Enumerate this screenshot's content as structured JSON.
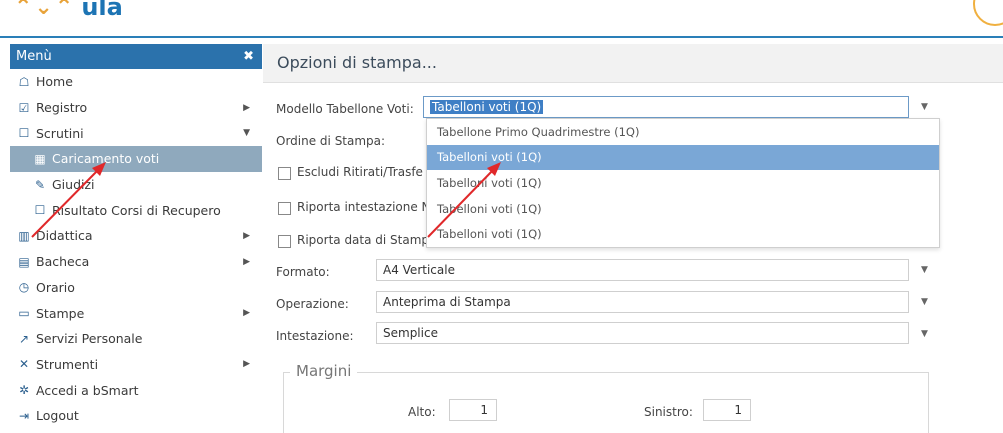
{
  "sidebar": {
    "title": "Menù",
    "close": "✖",
    "items": [
      {
        "label": "Home",
        "icon": "☖"
      },
      {
        "label": "Registro",
        "icon": "☑"
      },
      {
        "label": "Scrutini",
        "icon": "☐"
      },
      {
        "label": "Caricamento voti",
        "icon": "▦"
      },
      {
        "label": "Giudizi",
        "icon": "✎"
      },
      {
        "label": "Risultato Corsi di Recupero",
        "icon": "☐"
      },
      {
        "label": "Didattica",
        "icon": "▥"
      },
      {
        "label": "Bacheca",
        "icon": "▤"
      },
      {
        "label": "Orario",
        "icon": "◷"
      },
      {
        "label": "Stampe",
        "icon": "▭"
      },
      {
        "label": "Servizi Personale",
        "icon": "↗"
      },
      {
        "label": "Strumenti",
        "icon": "✕"
      },
      {
        "label": "Accedi a bSmart",
        "icon": "✲"
      },
      {
        "label": "Logout",
        "icon": "⇥"
      }
    ]
  },
  "main": {
    "title": "Opzioni di stampa...",
    "modello_label": "Modello Tabellone Voti:",
    "modello_value": "Tabelloni voti (1Q)",
    "ordine_label": "Ordine di Stampa:",
    "escludi_label": "Escludi Ritirati/Trasfe",
    "riporta_int_label": "Riporta intestazione N",
    "riporta_data_label": "Riporta data di Stamp",
    "dropdown_options": [
      "Tabellone Primo Quadrimestre (1Q)",
      "Tabelloni voti (1Q)",
      "Tabelloni voti (1Q)",
      "Tabelloni voti (1Q)",
      "Tabelloni voti (1Q)"
    ],
    "formato_label": "Formato:",
    "formato_value": "A4 Verticale",
    "operazione_label": "Operazione:",
    "operazione_value": "Anteprima di Stampa",
    "intestazione_label": "Intestazione:",
    "intestazione_value": "Semplice",
    "margini_legend": "Margini",
    "alto_label": "Alto:",
    "alto_value": "1",
    "sinistro_label": "Sinistro:",
    "sinistro_value": "1"
  },
  "colors": {
    "header_blue": "#2b72ac",
    "active_item": "#8fa9bd",
    "dropdown_selected": "#7aa7d6",
    "annotation_arrow": "#e0282a"
  }
}
